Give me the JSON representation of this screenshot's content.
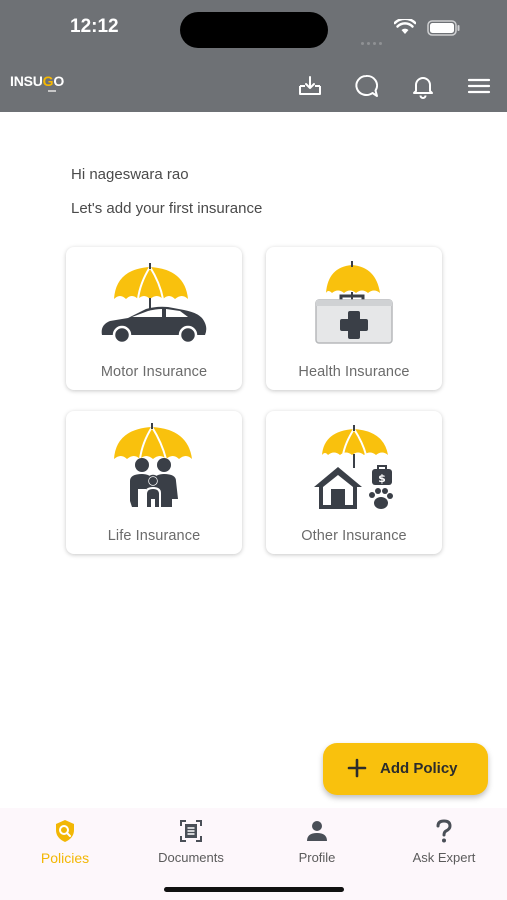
{
  "status_bar": {
    "time": "12:12"
  },
  "header": {
    "logo": {
      "prefix": "INSU",
      "accent": "G",
      "suffix": "O"
    },
    "icons": [
      "download-icon",
      "chat-icon",
      "bell-icon",
      "menu-icon"
    ]
  },
  "main": {
    "greeting": "Hi nageswara rao",
    "subtitle": "Let's add your first insurance",
    "cards": [
      {
        "label": "Motor Insurance",
        "icon": "car-umbrella-icon"
      },
      {
        "label": "Health Insurance",
        "icon": "medical-kit-umbrella-icon"
      },
      {
        "label": "Life Insurance",
        "icon": "family-umbrella-icon"
      },
      {
        "label": "Other Insurance",
        "icon": "home-pet-umbrella-icon"
      }
    ]
  },
  "fab": {
    "label": "Add Policy",
    "icon": "plus-icon"
  },
  "bottom_nav": {
    "items": [
      {
        "label": "Policies",
        "icon": "shield-search-icon",
        "active": true
      },
      {
        "label": "Documents",
        "icon": "document-icon",
        "active": false
      },
      {
        "label": "Profile",
        "icon": "person-icon",
        "active": false
      },
      {
        "label": "Ask Expert",
        "icon": "question-icon",
        "active": false
      }
    ]
  },
  "colors": {
    "accent": "#f9c10d",
    "header_bg": "#6e7175",
    "icon_dark": "#3a3f47"
  }
}
